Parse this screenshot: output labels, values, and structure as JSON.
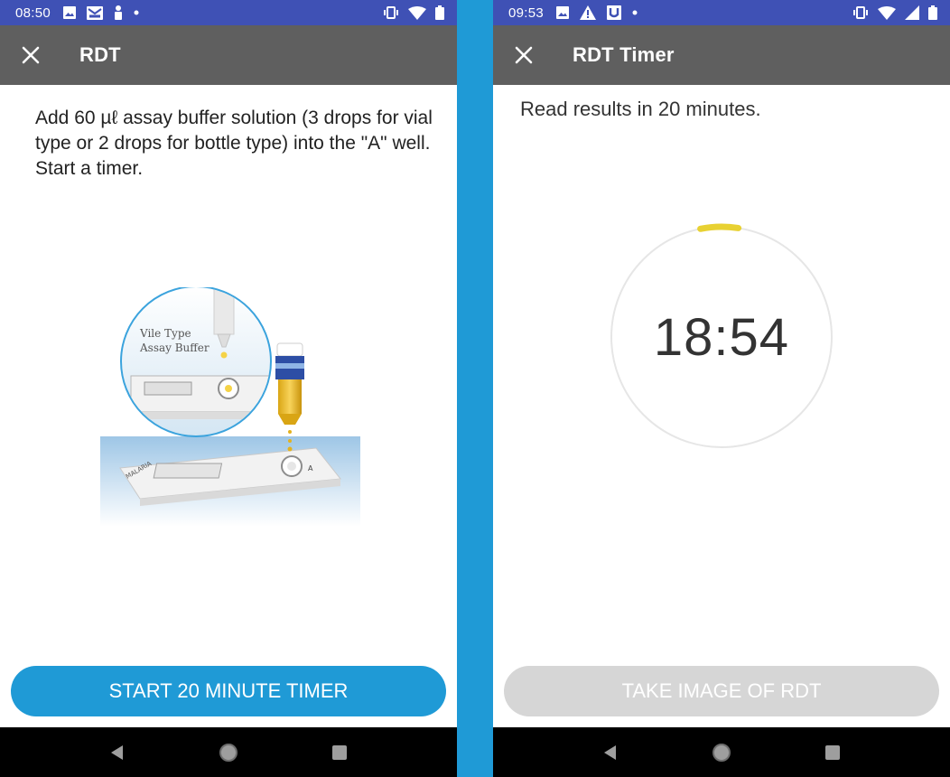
{
  "left_screen": {
    "status_bar": {
      "time": "08:50",
      "left_icons": [
        "image-icon",
        "mail-icon",
        "person-icon",
        "dot-icon"
      ],
      "right_icons": [
        "vibrate-icon",
        "wifi-icon",
        "battery-icon"
      ]
    },
    "app_bar": {
      "close_icon": "close-icon",
      "title": "RDT"
    },
    "instruction": {
      "line1": "Add 60 µℓ assay buffer solution (3 drops for vial type or 2 drops for bottle type) into the \"A\" well.",
      "line2": "Start a timer."
    },
    "illustration": {
      "label_line1": "Vile Type",
      "label_line2": "Assay Buffer",
      "cassette_label": "MALARIA",
      "well_label": "A"
    },
    "button_label": "START 20 MINUTE TIMER"
  },
  "right_screen": {
    "status_bar": {
      "time": "09:53",
      "left_icons": [
        "image-icon",
        "warning-icon",
        "u-app-icon",
        "dot-icon"
      ],
      "right_icons": [
        "vibrate-icon",
        "wifi-icon",
        "signal-icon",
        "battery-icon"
      ]
    },
    "app_bar": {
      "close_icon": "close-icon",
      "title": "RDT Timer"
    },
    "read_text": "Read results in 20 minutes.",
    "timer": {
      "display": "18:54",
      "progress_fraction": 0.055
    },
    "button_label": "TAKE IMAGE OF RDT",
    "button_enabled": false
  },
  "nav_bar": {
    "back": "back-triangle-icon",
    "home": "home-circle-icon",
    "recents": "recents-square-icon"
  },
  "colors": {
    "divider": "#1f9ad6",
    "status_bar": "#3f51b5",
    "app_bar": "#5f5f5f",
    "primary_button": "#1f9ad6",
    "disabled_button": "#d6d6d6",
    "timer_arc": "#e8d132",
    "timer_track": "#e6e6e6"
  }
}
